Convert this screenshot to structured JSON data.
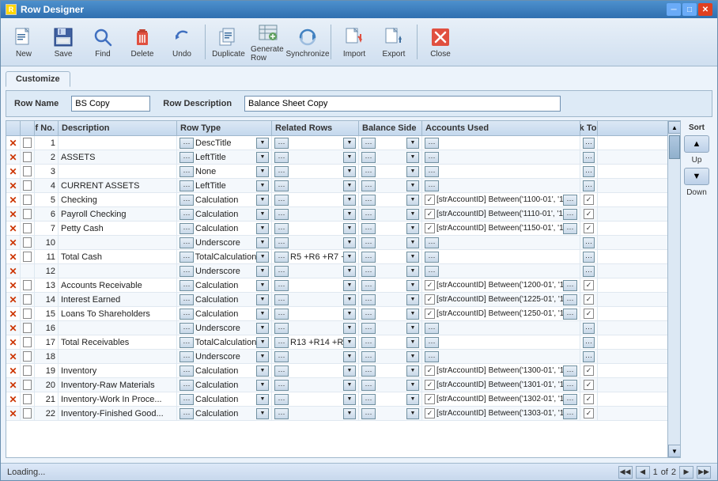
{
  "window": {
    "title": "Row Designer"
  },
  "toolbar": {
    "buttons": [
      {
        "id": "new",
        "label": "New",
        "icon": "new-icon"
      },
      {
        "id": "save",
        "label": "Save",
        "icon": "save-icon"
      },
      {
        "id": "find",
        "label": "Find",
        "icon": "find-icon"
      },
      {
        "id": "delete",
        "label": "Delete",
        "icon": "delete-icon"
      },
      {
        "id": "undo",
        "label": "Undo",
        "icon": "undo-icon"
      },
      {
        "id": "duplicate",
        "label": "Duplicate",
        "icon": "duplicate-icon"
      },
      {
        "id": "generate-row",
        "label": "Generate Row",
        "icon": "generate-row-icon"
      },
      {
        "id": "synchronize",
        "label": "Synchronize",
        "icon": "synchronize-icon"
      },
      {
        "id": "import",
        "label": "Import",
        "icon": "import-icon"
      },
      {
        "id": "export",
        "label": "Export",
        "icon": "export-icon"
      },
      {
        "id": "close",
        "label": "Close",
        "icon": "close-icon"
      }
    ]
  },
  "tab": "Customize",
  "form": {
    "row_name_label": "Row Name",
    "row_name_value": "BS Copy",
    "row_desc_label": "Row Description",
    "row_desc_value": "Balance Sheet Copy"
  },
  "grid": {
    "columns": [
      {
        "id": "x",
        "label": ""
      },
      {
        "id": "check",
        "label": ""
      },
      {
        "id": "ref",
        "label": "Ref No."
      },
      {
        "id": "desc",
        "label": "Description"
      },
      {
        "id": "rowtype",
        "label": "Row Type"
      },
      {
        "id": "related",
        "label": "Related Rows"
      },
      {
        "id": "balance",
        "label": "Balance Side"
      },
      {
        "id": "accounts",
        "label": "Accounts Used"
      },
      {
        "id": "link",
        "label": "Link To GL"
      }
    ],
    "rows": [
      {
        "ref": "1",
        "desc": "",
        "rowtype": "DescTitle",
        "related": "",
        "balance": "",
        "accounts": "",
        "link": false,
        "hasX": true,
        "hasCheck": true
      },
      {
        "ref": "2",
        "desc": "ASSETS",
        "rowtype": "LeftTitle",
        "related": "",
        "balance": "",
        "accounts": "",
        "link": false,
        "hasX": true,
        "hasCheck": true
      },
      {
        "ref": "3",
        "desc": "",
        "rowtype": "None",
        "related": "",
        "balance": "",
        "accounts": "",
        "link": false,
        "hasX": true,
        "hasCheck": true
      },
      {
        "ref": "4",
        "desc": "CURRENT ASSETS",
        "rowtype": "LeftTitle",
        "related": "",
        "balance": "",
        "accounts": "",
        "link": false,
        "hasX": true,
        "hasCheck": true
      },
      {
        "ref": "5",
        "desc": "Checking",
        "rowtype": "Calculation",
        "related": "",
        "balance": "",
        "accounts": "[strAccountID] Between('1100-01', '11...",
        "link": true,
        "hasX": true,
        "hasCheck": true
      },
      {
        "ref": "6",
        "desc": "Payroll Checking",
        "rowtype": "Calculation",
        "related": "",
        "balance": "",
        "accounts": "[strAccountID] Between('1110-01', '11...",
        "link": true,
        "hasX": true,
        "hasCheck": true
      },
      {
        "ref": "7",
        "desc": "Petty Cash",
        "rowtype": "Calculation",
        "related": "",
        "balance": "",
        "accounts": "[strAccountID] Between('1150-01', '11...",
        "link": true,
        "hasX": true,
        "hasCheck": true
      },
      {
        "ref": "10",
        "desc": "",
        "rowtype": "Underscore",
        "related": "",
        "balance": "",
        "accounts": "",
        "link": false,
        "hasX": true,
        "hasCheck": true
      },
      {
        "ref": "11",
        "desc": "Total Cash",
        "rowtype": "TotalCalculation",
        "related": "R5 +R6 +R7 +R...",
        "balance": "",
        "accounts": "",
        "link": false,
        "hasX": true,
        "hasCheck": true
      },
      {
        "ref": "12",
        "desc": "",
        "rowtype": "Underscore",
        "related": "",
        "balance": "",
        "accounts": "",
        "link": false,
        "hasX": true,
        "hasCheck": false
      },
      {
        "ref": "13",
        "desc": "Accounts Receivable",
        "rowtype": "Calculation",
        "related": "",
        "balance": "",
        "accounts": "[strAccountID] Between('1200-01', '12...",
        "link": true,
        "hasX": true,
        "hasCheck": true
      },
      {
        "ref": "14",
        "desc": "Interest Earned",
        "rowtype": "Calculation",
        "related": "",
        "balance": "",
        "accounts": "[strAccountID] Between('1225-01', '12...",
        "link": true,
        "hasX": true,
        "hasCheck": true
      },
      {
        "ref": "15",
        "desc": "Loans To Shareholders",
        "rowtype": "Calculation",
        "related": "",
        "balance": "",
        "accounts": "[strAccountID] Between('1250-01', '12...",
        "link": true,
        "hasX": true,
        "hasCheck": true
      },
      {
        "ref": "16",
        "desc": "",
        "rowtype": "Underscore",
        "related": "",
        "balance": "",
        "accounts": "",
        "link": false,
        "hasX": true,
        "hasCheck": true
      },
      {
        "ref": "17",
        "desc": "Total Receivables",
        "rowtype": "TotalCalculation",
        "related": "R13 +R14 +R15...",
        "balance": "",
        "accounts": "",
        "link": false,
        "hasX": true,
        "hasCheck": true
      },
      {
        "ref": "18",
        "desc": "",
        "rowtype": "Underscore",
        "related": "",
        "balance": "",
        "accounts": "",
        "link": false,
        "hasX": true,
        "hasCheck": true
      },
      {
        "ref": "19",
        "desc": "Inventory",
        "rowtype": "Calculation",
        "related": "",
        "balance": "",
        "accounts": "[strAccountID] Between('1300-01', '13...",
        "link": true,
        "hasX": true,
        "hasCheck": true
      },
      {
        "ref": "20",
        "desc": "Inventory-Raw Materials",
        "rowtype": "Calculation",
        "related": "",
        "balance": "",
        "accounts": "[strAccountID] Between('1301-01', '13...",
        "link": true,
        "hasX": true,
        "hasCheck": true
      },
      {
        "ref": "21",
        "desc": "Inventory-Work In Proce...",
        "rowtype": "Calculation",
        "related": "",
        "balance": "",
        "accounts": "[strAccountID] Between('1302-01', '13...",
        "link": true,
        "hasX": true,
        "hasCheck": true
      },
      {
        "ref": "22",
        "desc": "Inventory-Finished Good...",
        "rowtype": "Calculation",
        "related": "",
        "balance": "",
        "accounts": "[strAccountID] Between('1303-01', '13...",
        "link": true,
        "hasX": true,
        "hasCheck": true
      }
    ]
  },
  "sort": {
    "label": "Sort",
    "up_label": "Up",
    "down_label": "Down"
  },
  "status": {
    "loading": "Loading...",
    "page_current": "1",
    "page_total": "2"
  },
  "pagination": {
    "first": "◀◀",
    "prev": "◀",
    "next": "▶",
    "last": "▶▶",
    "of_label": "of"
  }
}
